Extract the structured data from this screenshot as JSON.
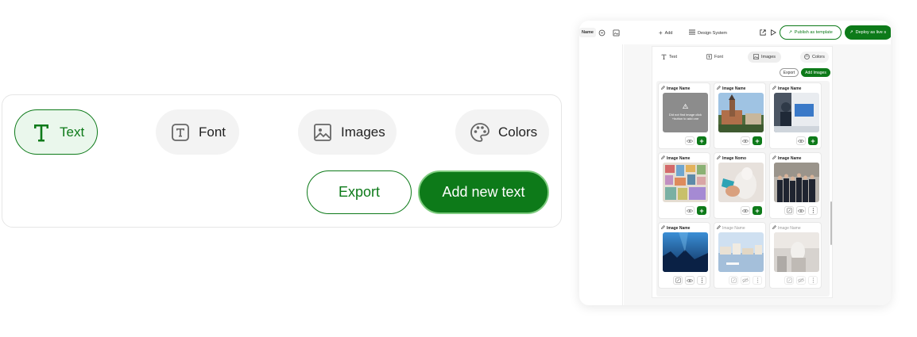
{
  "zoom_panel": {
    "tabs": [
      {
        "label": "Text",
        "icon": "text-icon",
        "active": true
      },
      {
        "label": "Font",
        "icon": "font-icon",
        "active": false
      },
      {
        "label": "Images",
        "icon": "image-icon",
        "active": false
      },
      {
        "label": "Colors",
        "icon": "palette-icon",
        "active": false
      }
    ],
    "export_label": "Export",
    "add_label": "Add new text"
  },
  "app": {
    "topbar": {
      "name_label": "Name",
      "add_label": "Add",
      "design_system_label": "Design System",
      "publish_label": "Publish as template",
      "deploy_label": "Deploy as live s"
    },
    "tabs": [
      {
        "label": "Text",
        "icon": "text-icon",
        "active": false
      },
      {
        "label": "Font",
        "icon": "font-icon",
        "active": false
      },
      {
        "label": "Images",
        "icon": "image-icon",
        "active": true
      },
      {
        "label": "Colors",
        "icon": "palette-icon",
        "active": false
      }
    ],
    "export_label": "Export",
    "add_images_label": "Add Images",
    "missing_text": "Did not find image click +button to add one",
    "cards": [
      {
        "name": "Image Name",
        "kind": "missing",
        "actions": [
          "eye",
          "plus"
        ]
      },
      {
        "name": "Image Name",
        "kind": "castle",
        "actions": [
          "eye",
          "plus"
        ]
      },
      {
        "name": "Image Name",
        "kind": "office",
        "actions": [
          "eye",
          "plus"
        ]
      },
      {
        "name": "Image Name",
        "kind": "collage",
        "actions": [
          "eye",
          "plus"
        ]
      },
      {
        "name": "Image Nomo",
        "kind": "sculpture",
        "actions": [
          "eye",
          "plus"
        ]
      },
      {
        "name": "Image Name",
        "kind": "group",
        "actions": [
          "swap",
          "eye",
          "more"
        ]
      },
      {
        "name": "Image Name",
        "kind": "underwater",
        "actions": [
          "swap",
          "eye",
          "more"
        ]
      },
      {
        "name": "Image Name",
        "kind": "harbor",
        "actions": [
          "swap",
          "eye-off",
          "more"
        ],
        "dim": true
      },
      {
        "name": "Image Name",
        "kind": "statue",
        "actions": [
          "swap",
          "eye-off",
          "more"
        ],
        "dim": true
      }
    ]
  },
  "colors": {
    "accent": "#0d7a19",
    "accent_light": "#eaf7ec"
  }
}
